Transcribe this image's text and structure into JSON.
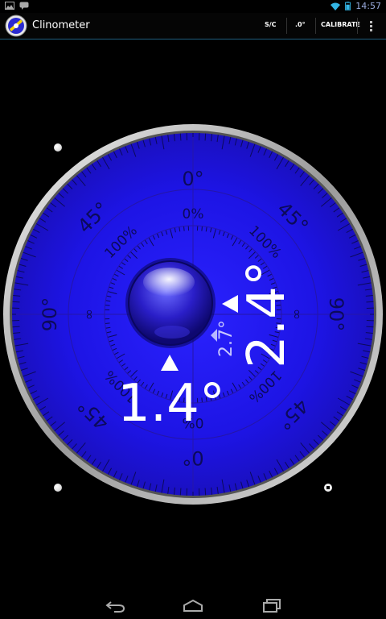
{
  "status_bar": {
    "time": "14:57",
    "icons": [
      "image-notification-icon",
      "chat-notification-icon",
      "wifi-icon",
      "battery-icon"
    ]
  },
  "action_bar": {
    "app_title": "Clinometer",
    "actions": {
      "sc_label": "S/C",
      "decimal_label": ".0°",
      "calibrate_label": "CALIBRATE"
    },
    "overflow_icon": "more-vert-icon"
  },
  "dial": {
    "outer_labels": {
      "top": "0°",
      "top_left": "45°",
      "top_right": "45°",
      "left": "90°",
      "right": "90°",
      "bottom_left": "45°",
      "bottom_right": "45°",
      "bottom": "0°"
    },
    "inner_labels": {
      "top": "0%",
      "top_left": "100%",
      "top_right": "100%",
      "left": "∞",
      "right": "∞",
      "bottom_left": "100%",
      "bottom_right": "100%",
      "bottom": "0%"
    },
    "readings": {
      "horizontal": "1.4°",
      "vertical": "2.4°",
      "combined": "2.7°"
    },
    "colors": {
      "face": "#1e12e0",
      "bezel": "#c8c8c8",
      "label": "#0c0a5a",
      "reading": "#ffffff"
    }
  },
  "nav_bar": {
    "icons": [
      "back-icon",
      "home-icon",
      "recent-apps-icon"
    ]
  }
}
